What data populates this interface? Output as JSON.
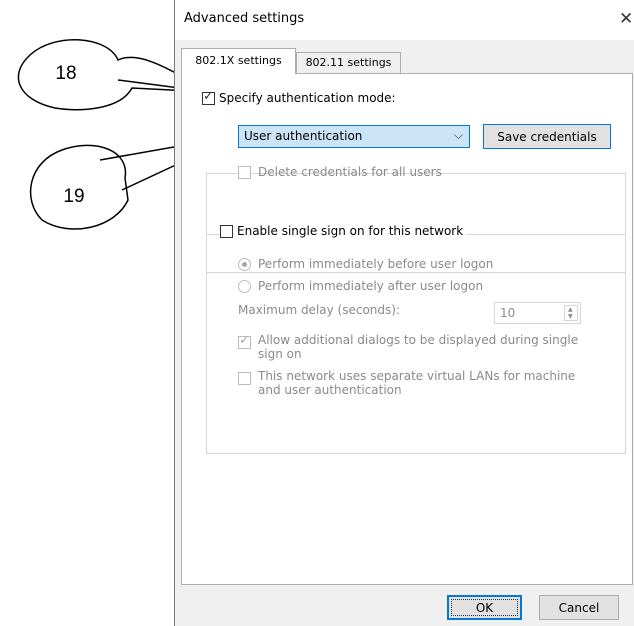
{
  "callouts": [
    "18",
    "19"
  ],
  "dialog": {
    "title": "Advanced settings",
    "close_glyph": "✕"
  },
  "tabs": [
    {
      "label": "802.1X settings",
      "active": true
    },
    {
      "label": "802.11 settings",
      "active": false
    }
  ],
  "auth": {
    "specify_mode_label": "Specify authentication mode:",
    "specify_mode_checked": true,
    "mode_selected": "User authentication",
    "save_credentials_label": "Save credentials",
    "delete_credentials_label": "Delete credentials for all users",
    "delete_credentials_checked": false
  },
  "sso": {
    "enable_label": "Enable single sign on for this network",
    "enable_checked": false,
    "before_logon_label": "Perform immediately before user logon",
    "before_logon_selected": true,
    "after_logon_label": "Perform immediately after user logon",
    "after_logon_selected": false,
    "max_delay_label": "Maximum delay (seconds):",
    "max_delay_value": "10",
    "allow_dialogs_label_line1": "Allow additional dialogs to be displayed during single",
    "allow_dialogs_label_line2": "sign on",
    "allow_dialogs_checked": true,
    "vlan_label_line1": "This network uses separate virtual LANs for machine",
    "vlan_label_line2": "and user authentication",
    "vlan_checked": false
  },
  "footer": {
    "ok_label": "OK",
    "cancel_label": "Cancel"
  },
  "colors": {
    "accent": "#0078d7",
    "dropdown_highlight": "#cce4f7"
  }
}
